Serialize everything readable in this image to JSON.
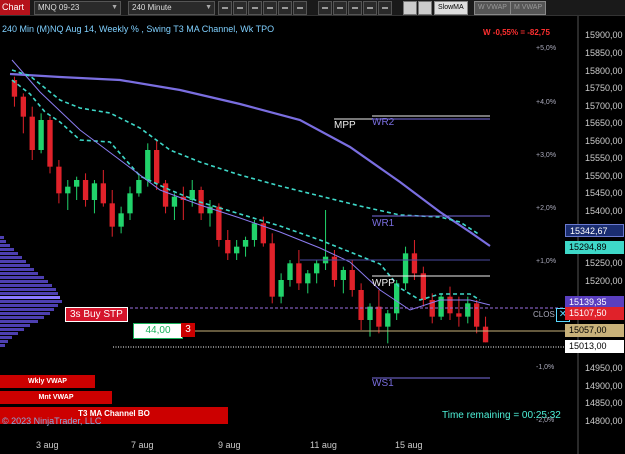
{
  "toolbar": {
    "window_title": "Chart",
    "instrument": "MNQ 09-23",
    "interval": "240 Minute",
    "indicator": "SlowMA",
    "tool1": "W VWAP",
    "tool2": "M VWAP"
  },
  "chart": {
    "title": "240 Min (M)NQ Aug 14, Weekly % , Swing T3 MA Channel, Wk TPO",
    "pl": "W -0,55% = -82,75",
    "time_remaining": "Time remaining = 00:25:32",
    "copyright": "© 2023 NinjaTrader, LLC"
  },
  "price_axis": [
    "15900,00",
    "15850,00",
    "15800,00",
    "15750,00",
    "15700,00",
    "15650,00",
    "15600,00",
    "15550,00",
    "15500,00",
    "15450,00",
    "15400,00",
    "15250,00",
    "15200,00",
    "14950,00",
    "14900,00",
    "14850,00",
    "14800,00"
  ],
  "pct_axis": [
    "+5,0%",
    "+4,0%",
    "+3,0%",
    "+2,0%",
    "+1,0%",
    "-1,0%",
    "-2,0%"
  ],
  "price_tags": [
    "15342,67",
    "15294,89",
    "15139,35",
    "15107,50",
    "15057,00",
    "15013,00"
  ],
  "dates": [
    "3 aug",
    "7 aug",
    "9 aug",
    "11 aug",
    "15 aug"
  ],
  "levels": {
    "mpp": "MPP",
    "wr2": "WR2",
    "wr1": "WR1",
    "wpp": "WPP",
    "ws1": "WS1",
    "clos": "CLOS"
  },
  "order": {
    "stop_label": "3s Buy STP",
    "price": "44,00",
    "qty": "3"
  },
  "indicators": {
    "wkly": "Wkly VWAP",
    "mnt": "Mnt VWAP",
    "t3": "T3 MA Channel BO"
  },
  "colors": {
    "bull": "#21d36b",
    "bear": "#e0222a",
    "ma": "#7a6ee0",
    "channel": "#3ed8c8"
  },
  "chart_data": {
    "type": "candlestick",
    "candles": [
      [
        15800,
        15810,
        15720,
        15750
      ],
      [
        15750,
        15760,
        15640,
        15690
      ],
      [
        15690,
        15720,
        15560,
        15590
      ],
      [
        15590,
        15700,
        15580,
        15680
      ],
      [
        15680,
        15690,
        15520,
        15540
      ],
      [
        15540,
        15560,
        15430,
        15460
      ],
      [
        15460,
        15500,
        15410,
        15480
      ],
      [
        15480,
        15510,
        15440,
        15500
      ],
      [
        15500,
        15520,
        15420,
        15440
      ],
      [
        15440,
        15500,
        15400,
        15490
      ],
      [
        15490,
        15530,
        15420,
        15430
      ],
      [
        15430,
        15470,
        15330,
        15360
      ],
      [
        15360,
        15420,
        15340,
        15400
      ],
      [
        15400,
        15480,
        15380,
        15460
      ],
      [
        15460,
        15520,
        15450,
        15500
      ],
      [
        15500,
        15610,
        15480,
        15590
      ],
      [
        15590,
        15620,
        15470,
        15490
      ],
      [
        15490,
        15500,
        15400,
        15420
      ],
      [
        15420,
        15460,
        15380,
        15450
      ],
      [
        15450,
        15480,
        15380,
        15440
      ],
      [
        15440,
        15500,
        15420,
        15470
      ],
      [
        15470,
        15480,
        15380,
        15400
      ],
      [
        15400,
        15440,
        15360,
        15420
      ],
      [
        15420,
        15430,
        15300,
        15320
      ],
      [
        15320,
        15350,
        15260,
        15280
      ],
      [
        15280,
        15320,
        15260,
        15300
      ],
      [
        15300,
        15330,
        15270,
        15320
      ],
      [
        15320,
        15380,
        15300,
        15370
      ],
      [
        15370,
        15390,
        15300,
        15310
      ],
      [
        15310,
        15340,
        15130,
        15150
      ],
      [
        15150,
        15220,
        15130,
        15200
      ],
      [
        15200,
        15260,
        15180,
        15250
      ],
      [
        15250,
        15290,
        15170,
        15190
      ],
      [
        15190,
        15230,
        15160,
        15220
      ],
      [
        15220,
        15260,
        15190,
        15250
      ],
      [
        15250,
        15410,
        15230,
        15270
      ],
      [
        15270,
        15290,
        15180,
        15200
      ],
      [
        15200,
        15240,
        15160,
        15230
      ],
      [
        15230,
        15260,
        15150,
        15170
      ],
      [
        15170,
        15190,
        15050,
        15080
      ],
      [
        15080,
        15130,
        15030,
        15120
      ],
      [
        15120,
        15170,
        15040,
        15060
      ],
      [
        15060,
        15110,
        15010,
        15100
      ],
      [
        15100,
        15200,
        15080,
        15190
      ],
      [
        15190,
        15300,
        15170,
        15280
      ],
      [
        15280,
        15320,
        15200,
        15220
      ],
      [
        15220,
        15240,
        15120,
        15140
      ],
      [
        15140,
        15160,
        15070,
        15090
      ],
      [
        15090,
        15160,
        15080,
        15150
      ],
      [
        15150,
        15180,
        15080,
        15100
      ],
      [
        15100,
        15150,
        15060,
        15090
      ],
      [
        15090,
        15150,
        15070,
        15130
      ],
      [
        15130,
        15140,
        15040,
        15060
      ],
      [
        15060,
        15090,
        15013,
        15013
      ]
    ],
    "ylim": [
      14750,
      15950
    ]
  }
}
